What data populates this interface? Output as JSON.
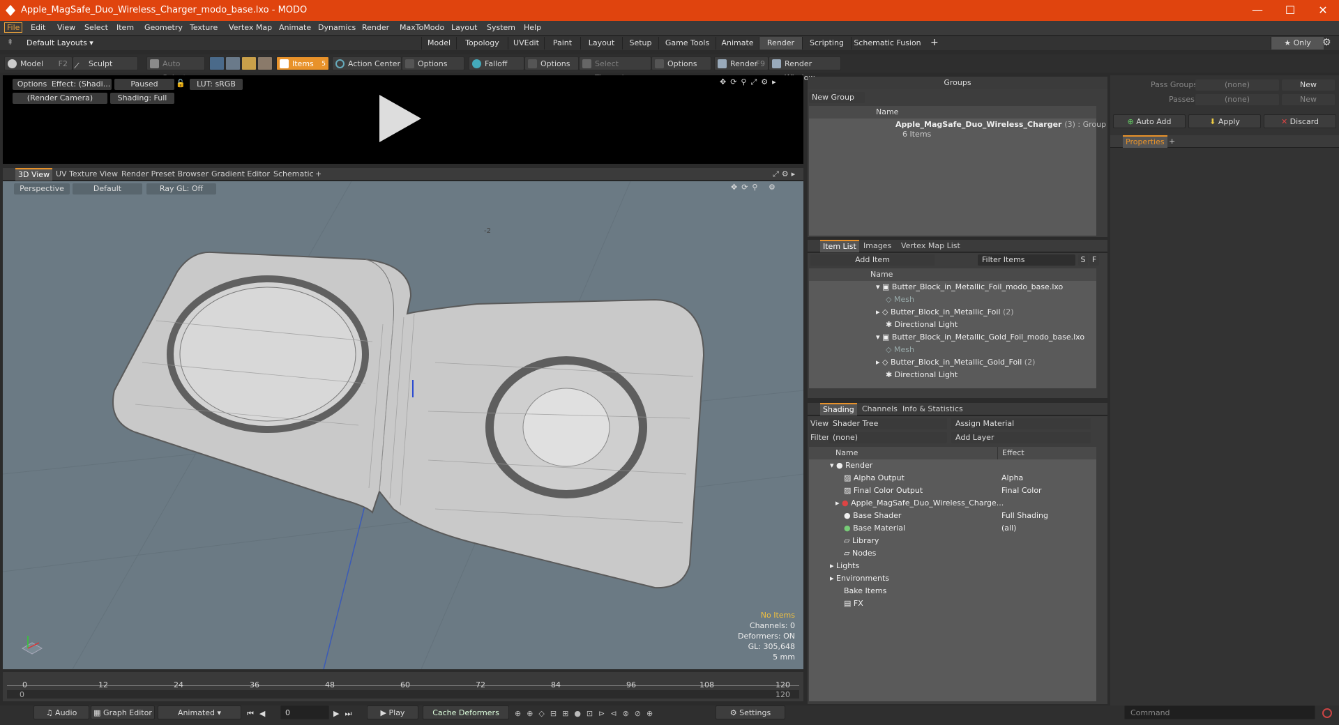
{
  "window": {
    "title": "Apple_MagSafe_Duo_Wireless_Charger_modo_base.lxo - MODO",
    "min": "—",
    "max": "☐",
    "close": "✕"
  },
  "menu": [
    "File",
    "Edit",
    "View",
    "Select",
    "Item",
    "Geometry",
    "Texture",
    "Vertex Map",
    "Animate",
    "Dynamics",
    "Render",
    "MaxToModo",
    "Layout",
    "System",
    "Help"
  ],
  "layouts": {
    "label": "Default Layouts ▾",
    "tabs": [
      "Model",
      "Topology",
      "UVEdit",
      "Paint",
      "Layout",
      "Setup",
      "Game Tools",
      "Animate",
      "Render",
      "Scripting",
      "Schematic Fusion"
    ],
    "active": "Render",
    "plus": "+",
    "only": "★ Only"
  },
  "toolbar": {
    "model": "Model",
    "model_key": "F2",
    "sculpt": "Sculpt",
    "auto_select": "Auto Select",
    "items": "Items",
    "items_key": "5",
    "action_center": "Action Center",
    "options1": "Options",
    "falloff": "Falloff",
    "options2": "Options",
    "select_through": "Select Through",
    "options3": "Options",
    "render": "Render",
    "render_key": "F9",
    "render_window": "Render Window"
  },
  "render_view": {
    "options": "Options",
    "effect": "Effect: (Shadi...",
    "paused": "Paused",
    "lut": "LUT: sRGB",
    "camera": "(Render Camera)",
    "shading": "Shading: Full"
  },
  "view_tabs": [
    "3D View",
    "UV Texture View",
    "Render Preset Browser",
    "Gradient Editor",
    "Schematic"
  ],
  "view_opts": {
    "perspective": "Perspective",
    "default": "Default",
    "raygl": "Ray GL: Off"
  },
  "viewport_stats": {
    "items": "No Items",
    "channels": "Channels: 0",
    "deformers": "Deformers: ON",
    "gl": "GL: 305,648",
    "scale": "5 mm"
  },
  "viewport_label": "-2",
  "timeline": {
    "ticks": [
      "0",
      "12",
      "24",
      "36",
      "48",
      "60",
      "72",
      "84",
      "96",
      "108",
      "120"
    ],
    "sub": [
      "0",
      "120"
    ]
  },
  "bottom": {
    "audio": "Audio",
    "graph_editor": "Graph Editor",
    "animated": "Animated",
    "frame": "0",
    "play": "Play",
    "cache": "Cache Deformers",
    "settings": "Settings",
    "command": "Command"
  },
  "groups": {
    "title": "Groups",
    "new_group": "New Group",
    "col_name": "Name",
    "item_name": "Apple_MagSafe_Duo_Wireless_Charger",
    "item_count": "(3) : Group",
    "item_sub": "6 Items"
  },
  "item_list": {
    "tabs": [
      "Item List",
      "Images",
      "Vertex Map List"
    ],
    "add_item": "Add Item",
    "filter": "Filter Items",
    "s": "S",
    "f": "F",
    "col_name": "Name",
    "rows": [
      {
        "label": "Butter_Block_in_Metallic_Foil_modo_base.lxo",
        "indent": 0,
        "dim": false
      },
      {
        "label": "Mesh",
        "indent": 1,
        "dim": true
      },
      {
        "label": "Butter_Block_in_Metallic_Foil",
        "suffix": "(2)",
        "indent": 1,
        "dim": false
      },
      {
        "label": "Directional Light",
        "indent": 1,
        "dim": false
      },
      {
        "label": "Butter_Block_in_Metallic_Gold_Foil_modo_base.lxo",
        "indent": 0,
        "dim": false
      },
      {
        "label": "Mesh",
        "indent": 1,
        "dim": true
      },
      {
        "label": "Butter_Block_in_Metallic_Gold_Foil",
        "suffix": "(2)",
        "indent": 1,
        "dim": false
      },
      {
        "label": "Directional Light",
        "indent": 1,
        "dim": false
      }
    ]
  },
  "shading": {
    "tabs": [
      "Shading",
      "Channels",
      "Info & Statistics"
    ],
    "view_label": "View",
    "view_value": "Shader Tree",
    "assign": "Assign Material",
    "filter_label": "Filter",
    "filter_value": "(none)",
    "add_layer": "Add Layer",
    "col_name": "Name",
    "col_effect": "Effect",
    "rows": [
      {
        "name": "Render",
        "effect": ""
      },
      {
        "name": "Alpha Output",
        "effect": "Alpha"
      },
      {
        "name": "Final Color Output",
        "effect": "Final Color"
      },
      {
        "name": "Apple_MagSafe_Duo_Wireless_Charge...",
        "effect": ""
      },
      {
        "name": "Base Shader",
        "effect": "Full Shading"
      },
      {
        "name": "Base Material",
        "effect": "(all)"
      },
      {
        "name": "Library",
        "effect": ""
      },
      {
        "name": "Nodes",
        "effect": ""
      },
      {
        "name": "Lights",
        "effect": ""
      },
      {
        "name": "Environments",
        "effect": ""
      },
      {
        "name": "Bake Items",
        "effect": ""
      },
      {
        "name": "FX",
        "effect": ""
      }
    ]
  },
  "right": {
    "pass_groups": "Pass Groups",
    "passes": "Passes",
    "none": "(none)",
    "new": "New",
    "auto_add": "Auto Add",
    "apply": "Apply",
    "discard": "Discard",
    "properties": "Properties",
    "plus": "+"
  }
}
